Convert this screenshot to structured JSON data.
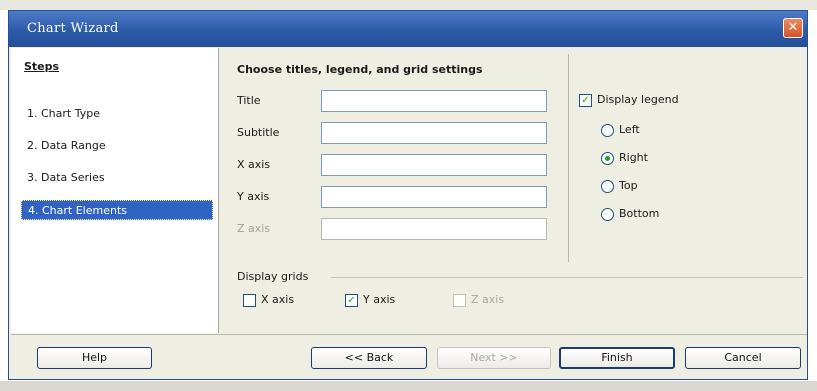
{
  "window": {
    "title": "Chart Wizard"
  },
  "steps": {
    "header": "Steps",
    "items": [
      {
        "label": "1.  Chart Type"
      },
      {
        "label": "2.  Data Range"
      },
      {
        "label": "3.  Data Series"
      },
      {
        "label": "4.  Chart Elements",
        "active": true
      }
    ]
  },
  "content": {
    "header": "Choose titles, legend, and grid settings",
    "fields": [
      {
        "label": "Title",
        "value": "",
        "enabled": true
      },
      {
        "label": "Subtitle",
        "value": "",
        "enabled": true
      },
      {
        "label": "X axis",
        "value": "",
        "enabled": true
      },
      {
        "label": "Y axis",
        "value": "",
        "enabled": true
      },
      {
        "label": "Z axis",
        "value": "",
        "enabled": false
      }
    ]
  },
  "legend": {
    "checkbox_label": "Display legend",
    "checked": true,
    "options": [
      "Left",
      "Right",
      "Top",
      "Bottom"
    ],
    "selected": "Right"
  },
  "grids": {
    "label": "Display grids",
    "items": [
      {
        "label": "X axis",
        "checked": false,
        "enabled": true
      },
      {
        "label": "Y axis",
        "checked": true,
        "enabled": true
      },
      {
        "label": "Z axis",
        "checked": false,
        "enabled": false
      }
    ]
  },
  "buttons": {
    "help": "Help",
    "back": "<< Back",
    "next": "Next >>",
    "finish": "Finish",
    "cancel": "Cancel"
  },
  "colors": {
    "titlebar": "#2d5aa8",
    "selection": "#3164c2",
    "check_mark": "#21a121",
    "dialog_bg": "#efeee2"
  }
}
